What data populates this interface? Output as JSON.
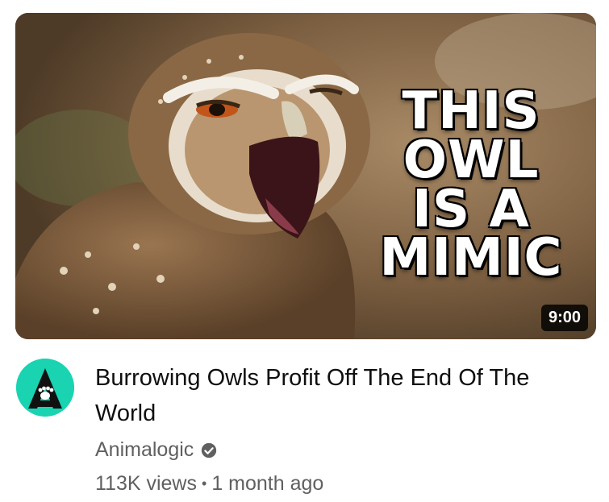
{
  "thumbnail": {
    "overlay_lines": [
      "THIS",
      "OWL",
      "IS A",
      "MIMIC"
    ],
    "duration": "9:00"
  },
  "video": {
    "title": "Burrowing Owls Profit Off The End Of The World"
  },
  "channel": {
    "name": "Animalogic",
    "verified_icon": "verified-check-icon",
    "avatar_color": "#19d3b1"
  },
  "meta": {
    "views": "113K views",
    "separator": "•",
    "age": "1 month ago"
  }
}
